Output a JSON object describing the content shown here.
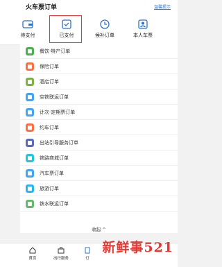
{
  "header": {
    "title": "火车票订单",
    "notice": "温馨提示"
  },
  "tabs": [
    {
      "label": "待支付"
    },
    {
      "label": "已支付"
    },
    {
      "label": "候补订单"
    },
    {
      "label": "本人车票"
    }
  ],
  "list": [
    {
      "label": "餐饮·特产订单",
      "color": "#4caf50"
    },
    {
      "label": "保险订单",
      "color": "#ff7043"
    },
    {
      "label": "酒店订单",
      "color": "#7cb342"
    },
    {
      "label": "空铁联运订单",
      "color": "#42a5f5"
    },
    {
      "label": "计次·定期票订单",
      "color": "#42a5f5"
    },
    {
      "label": "约车订单",
      "color": "#ff7043"
    },
    {
      "label": "出站引导服务订单",
      "color": "#5c6bc0"
    },
    {
      "label": "铁路商城订单",
      "color": "#26c6da"
    },
    {
      "label": "汽车票订单",
      "color": "#42a5f5"
    },
    {
      "label": "旅游订单",
      "color": "#29b6f6"
    },
    {
      "label": "铁水联运订单",
      "color": "#66bb6a"
    }
  ],
  "collapse": "收起 ^",
  "bottom_nav": [
    {
      "label": "首页"
    },
    {
      "label": "出行服务"
    },
    {
      "label": "订"
    }
  ],
  "watermark": "新鲜事521",
  "highlight_color": "#e53935"
}
